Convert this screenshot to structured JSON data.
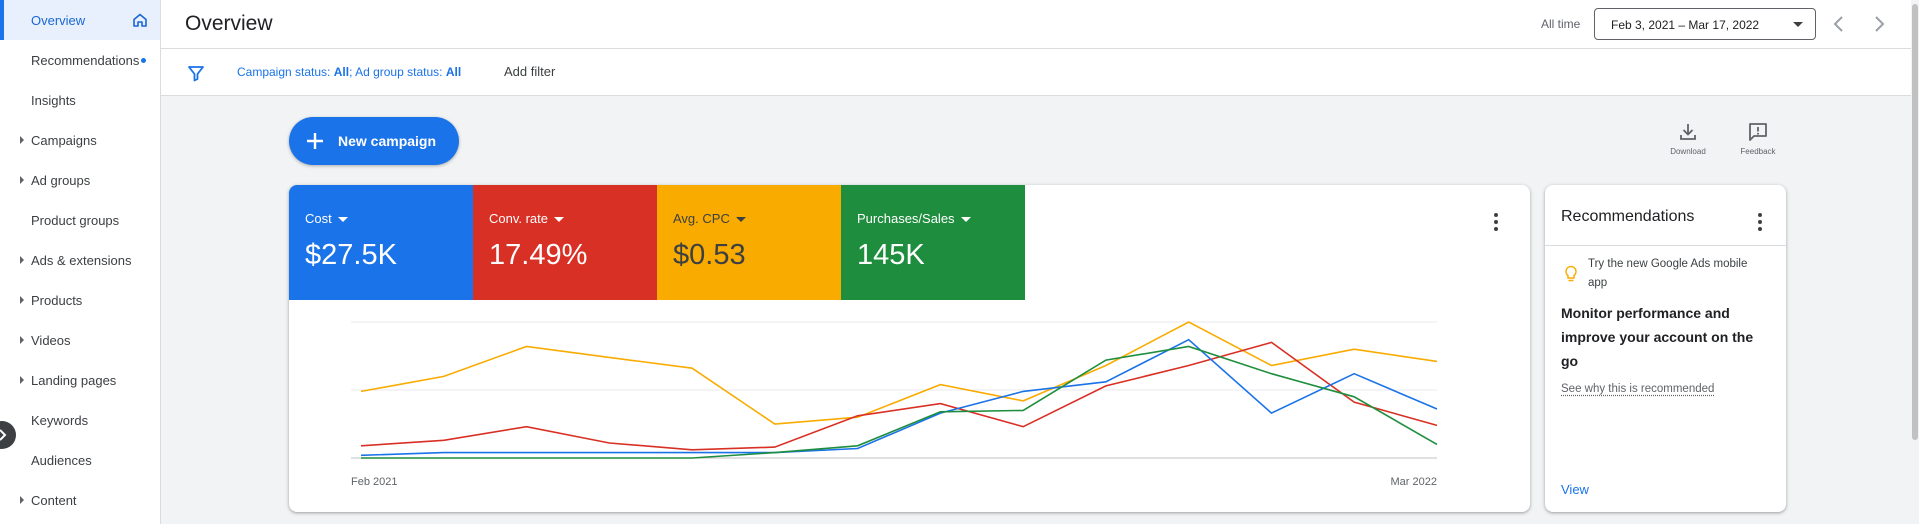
{
  "sidebar": {
    "items": [
      {
        "label": "Overview",
        "active": true,
        "has_caret": false
      },
      {
        "label": "Recommendations",
        "has_caret": false,
        "badge_dot": true
      },
      {
        "label": "Insights",
        "has_caret": false
      },
      {
        "label": "Campaigns",
        "has_caret": true
      },
      {
        "label": "Ad groups",
        "has_caret": true
      },
      {
        "label": "Product groups",
        "has_caret": false
      },
      {
        "label": "Ads & extensions",
        "has_caret": true
      },
      {
        "label": "Products",
        "has_caret": true
      },
      {
        "label": "Videos",
        "has_caret": true
      },
      {
        "label": "Landing pages",
        "has_caret": true
      },
      {
        "label": "Keywords",
        "has_caret": false
      },
      {
        "label": "Audiences",
        "has_caret": false
      },
      {
        "label": "Content",
        "has_caret": true
      }
    ]
  },
  "header": {
    "title": "Overview",
    "range_label": "All time",
    "date_range": "Feb 3, 2021 – Mar 17, 2022"
  },
  "filters": {
    "campaign_status_label": "Campaign status: ",
    "campaign_status_value": "All",
    "separator": "; ",
    "ad_group_status_label": "Ad group status: ",
    "ad_group_status_value": "All",
    "add_filter": "Add filter"
  },
  "actions": {
    "new_campaign": "New campaign",
    "download": "Download",
    "feedback": "Feedback"
  },
  "metrics": [
    {
      "label": "Cost",
      "value": "$27.5K",
      "color": "#1a73e8"
    },
    {
      "label": "Conv. rate",
      "value": "17.49%",
      "color": "#d93025"
    },
    {
      "label": "Avg. CPC",
      "value": "$0.53",
      "color": "#f9ab00"
    },
    {
      "label": "Purchases/Sales",
      "value": "145K",
      "color": "#1e8e3e"
    }
  ],
  "chart_data": {
    "type": "line",
    "x_start_label": "Feb 2021",
    "x_end_label": "Mar 2022",
    "points_per_series": 14,
    "grid": true,
    "series": [
      {
        "color": "#f9ab00",
        "values": [
          0.49,
          0.6,
          0.82,
          0.74,
          0.66,
          0.25,
          0.3,
          0.54,
          0.42,
          0.68,
          1.0,
          0.68,
          0.8,
          0.71
        ]
      },
      {
        "color": "#d93025",
        "values": [
          0.09,
          0.13,
          0.23,
          0.11,
          0.06,
          0.08,
          0.31,
          0.4,
          0.23,
          0.53,
          0.68,
          0.85,
          0.41,
          0.24
        ]
      },
      {
        "color": "#1a73e8",
        "values": [
          0.02,
          0.04,
          0.04,
          0.04,
          0.04,
          0.04,
          0.07,
          0.33,
          0.49,
          0.56,
          0.87,
          0.33,
          0.62,
          0.36
        ]
      },
      {
        "color": "#1e8e3e",
        "values": [
          0.0,
          0.0,
          0.0,
          0.0,
          0.0,
          0.04,
          0.09,
          0.34,
          0.35,
          0.72,
          0.82,
          0.62,
          0.45,
          0.1
        ]
      }
    ]
  },
  "recommendations": {
    "title": "Recommendations",
    "hint": "Try the new Google Ads mobile app",
    "headline": "Monitor performance and improve your account on the go",
    "why": "See why this is recommended",
    "view": "View"
  }
}
